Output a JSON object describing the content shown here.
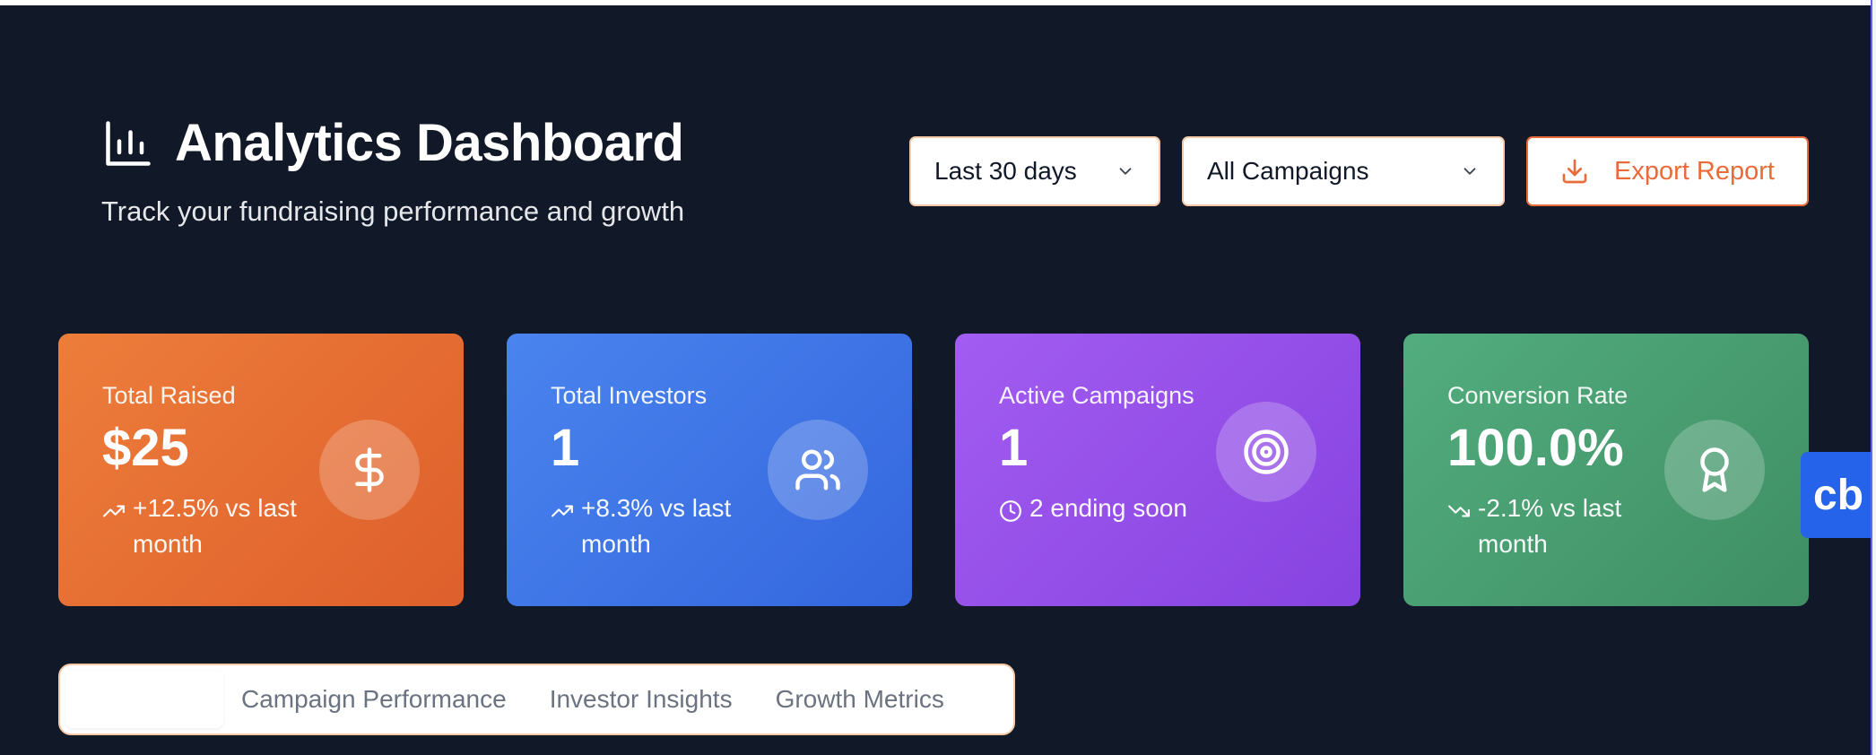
{
  "header": {
    "title": "Analytics Dashboard",
    "subtitle": "Track your fundraising performance and growth",
    "title_icon": "bar-chart-icon"
  },
  "filters": {
    "date_range": {
      "selected": "Last 30 days"
    },
    "campaign": {
      "selected": "All Campaigns"
    }
  },
  "actions": {
    "export_label": "Export Report",
    "export_icon": "download-icon"
  },
  "stats": [
    {
      "label": "Total Raised",
      "value": "$25",
      "trend": "+12.5% vs last month",
      "trend_direction": "up",
      "icon": "dollar-icon",
      "color": "#ea6f35"
    },
    {
      "label": "Total Investors",
      "value": "1",
      "trend": "+8.3% vs last month",
      "trend_direction": "up",
      "icon": "users-icon",
      "color": "#3f75e6"
    },
    {
      "label": "Active Campaigns",
      "value": "1",
      "trend": "2 ending soon",
      "trend_icon": "clock-icon",
      "icon": "target-icon",
      "color": "#954fe8"
    },
    {
      "label": "Conversion Rate",
      "value": "100.0%",
      "trend": "-2.1% vs last month",
      "trend_direction": "down",
      "icon": "award-icon",
      "color": "#4a9e72"
    }
  ],
  "tabs": [
    {
      "label": ""
    },
    {
      "label": "Campaign Performance"
    },
    {
      "label": "Investor Insights"
    },
    {
      "label": "Growth Metrics"
    }
  ],
  "badge": {
    "text": "cb"
  },
  "colors": {
    "background": "#111827",
    "accent": "#ea6b3a",
    "border": "#f7c9a8"
  }
}
